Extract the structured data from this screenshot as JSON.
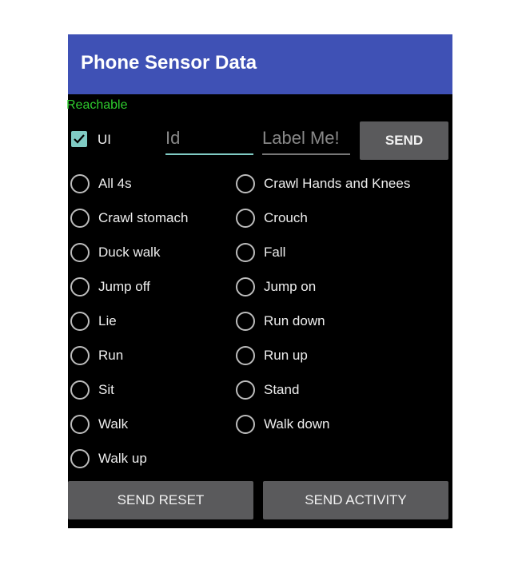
{
  "app": {
    "title": "Phone Sensor Data"
  },
  "status": {
    "text": "Reachable",
    "color": "#2ecc2e"
  },
  "controls": {
    "ui_checkbox": {
      "label": "UI",
      "checked": true
    },
    "id_field": {
      "placeholder": "Id",
      "value": ""
    },
    "label_field": {
      "placeholder": "Label Me!",
      "value": ""
    },
    "send_label": "SEND"
  },
  "activities": {
    "left": [
      "All 4s",
      "Crawl stomach",
      "Duck walk",
      "Jump off",
      "Lie",
      "Run",
      "Sit",
      "Walk",
      "Walk up"
    ],
    "right": [
      "Crawl Hands and Knees",
      "Crouch",
      "Fall",
      "Jump on",
      "Run down",
      "Run up",
      "Stand",
      "Walk down"
    ]
  },
  "footer": {
    "reset_label": "SEND RESET",
    "activity_label": "SEND ACTIVITY"
  },
  "colors": {
    "appbar": "#3f51b5",
    "accent": "#80cbc4",
    "button": "#5a5a5c"
  }
}
